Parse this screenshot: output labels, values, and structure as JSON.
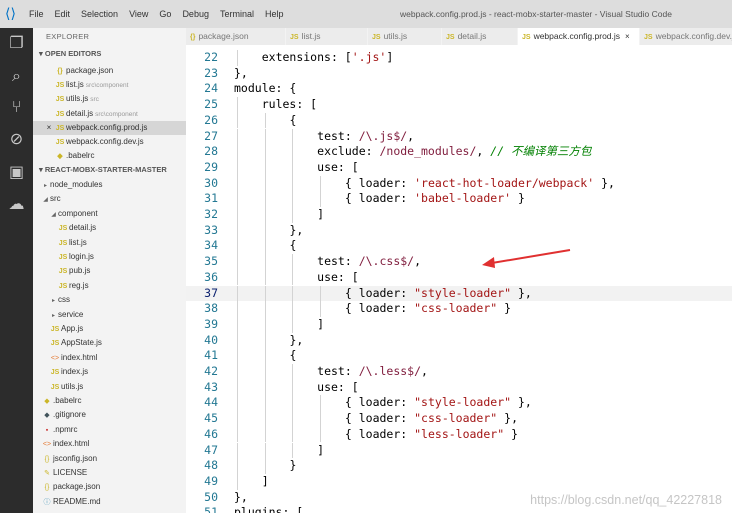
{
  "titlebar": {
    "menu": [
      "File",
      "Edit",
      "Selection",
      "View",
      "Go",
      "Debug",
      "Terminal",
      "Help"
    ],
    "title": "webpack.config.prod.js - react-mobx-starter-master - Visual Studio Code"
  },
  "sidebar": {
    "explorer_label": "EXPLORER",
    "open_editors_label": "OPEN EDITORS",
    "open_editors": [
      {
        "name": "package.json",
        "icon": "{}",
        "path": ""
      },
      {
        "name": "list.js",
        "icon": "JS",
        "path": "src\\component"
      },
      {
        "name": "utils.js",
        "icon": "JS",
        "path": "src"
      },
      {
        "name": "detail.js",
        "icon": "JS",
        "path": "src\\component"
      },
      {
        "name": "webpack.config.prod.js",
        "icon": "JS",
        "path": "",
        "active": true
      },
      {
        "name": "webpack.config.dev.js",
        "icon": "JS",
        "path": ""
      },
      {
        "name": ".babelrc",
        "icon": "◆",
        "path": ""
      }
    ],
    "project_label": "REACT-MOBX-STARTER-MASTER",
    "tree": [
      {
        "name": "node_modules",
        "type": "folder"
      },
      {
        "name": "src",
        "type": "folder-open"
      },
      {
        "name": "component",
        "type": "folder-open"
      },
      {
        "name": "detail.js",
        "type": "js"
      },
      {
        "name": "list.js",
        "type": "js"
      },
      {
        "name": "login.js",
        "type": "js"
      },
      {
        "name": "pub.js",
        "type": "js"
      },
      {
        "name": "reg.js",
        "type": "js"
      },
      {
        "name": "css",
        "type": "folder"
      },
      {
        "name": "service",
        "type": "folder"
      },
      {
        "name": "App.js",
        "type": "js"
      },
      {
        "name": "AppState.js",
        "type": "js"
      },
      {
        "name": "index.html",
        "type": "html"
      },
      {
        "name": "index.js",
        "type": "js"
      },
      {
        "name": "utils.js",
        "type": "js"
      },
      {
        "name": ".babelrc",
        "type": "babel"
      },
      {
        "name": ".gitignore",
        "type": "git"
      },
      {
        "name": ".npmrc",
        "type": "npm"
      },
      {
        "name": "index.html",
        "type": "html"
      },
      {
        "name": "jsconfig.json",
        "type": "json"
      },
      {
        "name": "LICENSE",
        "type": "lic"
      },
      {
        "name": "package.json",
        "type": "json"
      },
      {
        "name": "README.md",
        "type": "md"
      }
    ]
  },
  "tabs": [
    {
      "label": "package.json",
      "icon": "{}"
    },
    {
      "label": "list.js",
      "icon": "JS"
    },
    {
      "label": "utils.js",
      "icon": "JS"
    },
    {
      "label": "detail.js",
      "icon": "JS"
    },
    {
      "label": "webpack.config.prod.js",
      "icon": "JS",
      "active": true,
      "close": "×"
    },
    {
      "label": "webpack.config.dev.js",
      "icon": "JS"
    }
  ],
  "editor": {
    "lines": [
      {
        "n": 22,
        "indent": 2,
        "tokens": [
          [
            "p",
            "extensions: ["
          ],
          [
            "s",
            "'.js'"
          ],
          [
            "p",
            "]"
          ]
        ]
      },
      {
        "n": 23,
        "indent": 1,
        "tokens": [
          [
            "p",
            "},"
          ]
        ]
      },
      {
        "n": 24,
        "indent": 1,
        "tokens": [
          [
            "p",
            "module: {"
          ]
        ]
      },
      {
        "n": 25,
        "indent": 2,
        "tokens": [
          [
            "p",
            "rules: ["
          ]
        ]
      },
      {
        "n": 26,
        "indent": 3,
        "tokens": [
          [
            "p",
            "{"
          ]
        ]
      },
      {
        "n": 27,
        "indent": 4,
        "tokens": [
          [
            "p",
            "test: "
          ],
          [
            "r",
            "/\\.js$/"
          ],
          [
            "p",
            ","
          ]
        ]
      },
      {
        "n": 28,
        "indent": 4,
        "tokens": [
          [
            "p",
            "exclude: "
          ],
          [
            "r",
            "/node_modules/"
          ],
          [
            "p",
            ", "
          ],
          [
            "c",
            "// 不编译第三方包"
          ]
        ]
      },
      {
        "n": 29,
        "indent": 4,
        "tokens": [
          [
            "p",
            "use: ["
          ]
        ]
      },
      {
        "n": 30,
        "indent": 5,
        "tokens": [
          [
            "p",
            "{ loader: "
          ],
          [
            "s",
            "'react-hot-loader/webpack'"
          ],
          [
            "p",
            " },"
          ]
        ]
      },
      {
        "n": 31,
        "indent": 5,
        "tokens": [
          [
            "p",
            "{ loader: "
          ],
          [
            "s",
            "'babel-loader'"
          ],
          [
            "p",
            " }"
          ]
        ]
      },
      {
        "n": 32,
        "indent": 4,
        "tokens": [
          [
            "p",
            "]"
          ]
        ]
      },
      {
        "n": 33,
        "indent": 3,
        "tokens": [
          [
            "p",
            "},"
          ]
        ]
      },
      {
        "n": 34,
        "indent": 3,
        "tokens": [
          [
            "p",
            "{"
          ]
        ]
      },
      {
        "n": 35,
        "indent": 4,
        "tokens": [
          [
            "p",
            "test: "
          ],
          [
            "r",
            "/\\.css$/"
          ],
          [
            "p",
            ","
          ]
        ]
      },
      {
        "n": 36,
        "indent": 4,
        "tokens": [
          [
            "p",
            "use: ["
          ]
        ]
      },
      {
        "n": 37,
        "indent": 5,
        "tokens": [
          [
            "p",
            "{ loader: "
          ],
          [
            "s",
            "\"style-loader\""
          ],
          [
            "p",
            " },"
          ]
        ],
        "current": true
      },
      {
        "n": 38,
        "indent": 5,
        "tokens": [
          [
            "p",
            "{ loader: "
          ],
          [
            "s",
            "\"css-loader\""
          ],
          [
            "p",
            " }"
          ]
        ]
      },
      {
        "n": 39,
        "indent": 4,
        "tokens": [
          [
            "p",
            "]"
          ]
        ]
      },
      {
        "n": 40,
        "indent": 3,
        "tokens": [
          [
            "p",
            "},"
          ]
        ]
      },
      {
        "n": 41,
        "indent": 3,
        "tokens": [
          [
            "p",
            "{"
          ]
        ]
      },
      {
        "n": 42,
        "indent": 4,
        "tokens": [
          [
            "p",
            "test: "
          ],
          [
            "r",
            "/\\.less$/"
          ],
          [
            "p",
            ","
          ]
        ]
      },
      {
        "n": 43,
        "indent": 4,
        "tokens": [
          [
            "p",
            "use: ["
          ]
        ]
      },
      {
        "n": 44,
        "indent": 5,
        "tokens": [
          [
            "p",
            "{ loader: "
          ],
          [
            "s",
            "\"style-loader\""
          ],
          [
            "p",
            " },"
          ]
        ]
      },
      {
        "n": 45,
        "indent": 5,
        "tokens": [
          [
            "p",
            "{ loader: "
          ],
          [
            "s",
            "\"css-loader\""
          ],
          [
            "p",
            " },"
          ]
        ]
      },
      {
        "n": 46,
        "indent": 5,
        "tokens": [
          [
            "p",
            "{ loader: "
          ],
          [
            "s",
            "\"less-loader\""
          ],
          [
            "p",
            " }"
          ]
        ]
      },
      {
        "n": 47,
        "indent": 4,
        "tokens": [
          [
            "p",
            "]"
          ]
        ]
      },
      {
        "n": 48,
        "indent": 3,
        "tokens": [
          [
            "p",
            "}"
          ]
        ]
      },
      {
        "n": 49,
        "indent": 2,
        "tokens": [
          [
            "p",
            "]"
          ]
        ]
      },
      {
        "n": 50,
        "indent": 1,
        "tokens": [
          [
            "p",
            "},"
          ]
        ]
      },
      {
        "n": 51,
        "indent": 1,
        "tokens": [
          [
            "p",
            "plugins: ["
          ]
        ]
      }
    ]
  },
  "watermark": "https://blog.csdn.net/qq_42227818",
  "colors": {
    "string": "#a31515",
    "regex": "#811f3f",
    "comment": "#008000",
    "line_number": "#237893",
    "annotation_arrow": "#e03030"
  }
}
